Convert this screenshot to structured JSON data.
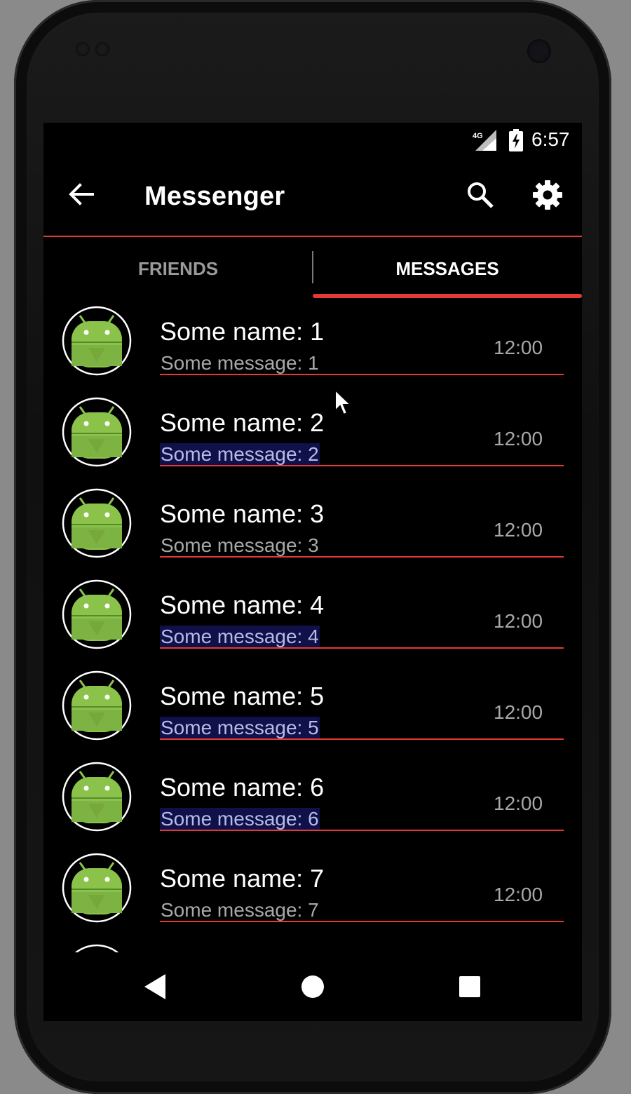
{
  "status_bar": {
    "network_label": "4G",
    "time": "6:57"
  },
  "toolbar": {
    "title": "Messenger",
    "icons": [
      "back-arrow-icon",
      "search-icon",
      "gear-icon"
    ]
  },
  "tabs": [
    {
      "label": "FRIENDS",
      "selected": false
    },
    {
      "label": "MESSAGES",
      "selected": true
    }
  ],
  "conversations": [
    {
      "name": "Some name: 1",
      "message": "Some message: 1",
      "time": "12:00",
      "highlighted": false
    },
    {
      "name": "Some name: 2",
      "message": "Some message: 2",
      "time": "12:00",
      "highlighted": true
    },
    {
      "name": "Some name: 3",
      "message": "Some message: 3",
      "time": "12:00",
      "highlighted": false
    },
    {
      "name": "Some name: 4",
      "message": "Some message: 4",
      "time": "12:00",
      "highlighted": true
    },
    {
      "name": "Some name: 5",
      "message": "Some message: 5",
      "time": "12:00",
      "highlighted": true
    },
    {
      "name": "Some name: 6",
      "message": "Some message: 6",
      "time": "12:00",
      "highlighted": true
    },
    {
      "name": "Some name: 7",
      "message": "Some message: 7",
      "time": "12:00",
      "highlighted": false
    }
  ],
  "nav_bar": {
    "icons": [
      "nav-back-icon",
      "nav-home-icon",
      "nav-recents-icon"
    ]
  },
  "colors": {
    "accent": "#e53935",
    "background": "#000000",
    "avatar_green": "#8bc34a",
    "highlight": "#10104a",
    "secondary_text": "#a8a8a8"
  }
}
